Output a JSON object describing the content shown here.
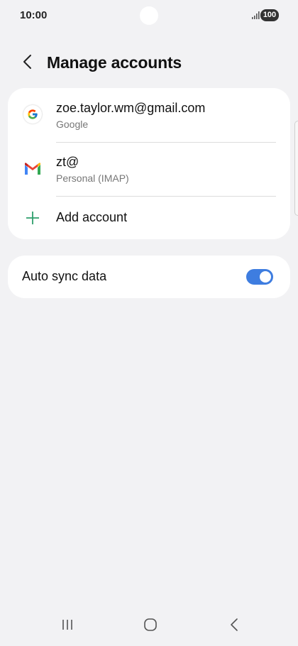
{
  "status_bar": {
    "time": "10:00",
    "battery": "100",
    "signal_icon": "signal-icon"
  },
  "header": {
    "back_icon": "chevron-left-icon",
    "title": "Manage accounts"
  },
  "accounts": [
    {
      "title": "zoe.taylor.wm@gmail.com",
      "subtitle": "Google",
      "icon": "google-icon"
    },
    {
      "title": "zt@",
      "subtitle": "Personal (IMAP)",
      "icon": "gmail-icon"
    }
  ],
  "add_account": {
    "label": "Add account",
    "icon": "plus-icon",
    "color": "#2e9e6b"
  },
  "auto_sync": {
    "label": "Auto sync data",
    "enabled": true,
    "color": "#3e7de0"
  },
  "nav_bar": {
    "recents_icon": "recents-icon",
    "home_icon": "home-icon",
    "back_icon": "back-icon"
  }
}
